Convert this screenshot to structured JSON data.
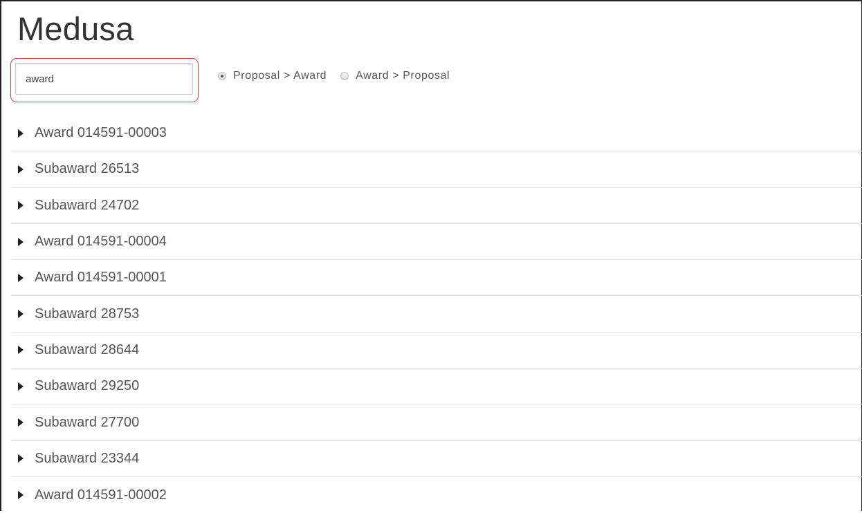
{
  "page": {
    "title": "Medusa"
  },
  "search": {
    "value": "award"
  },
  "direction": {
    "options": [
      {
        "label": "Proposal > Award",
        "checked": true
      },
      {
        "label": "Award > Proposal",
        "checked": false
      }
    ]
  },
  "colors": {
    "highlight": "#e0393e",
    "text": "#555555",
    "divider": "#e1e1e1"
  },
  "results": {
    "items": [
      {
        "label": "Award 014591-00003",
        "icon": "caret-right-icon"
      },
      {
        "label": "Subaward 26513",
        "icon": "caret-right-icon"
      },
      {
        "label": "Subaward 24702",
        "icon": "caret-right-icon"
      },
      {
        "label": "Award 014591-00004",
        "icon": "caret-right-icon"
      },
      {
        "label": "Award 014591-00001",
        "icon": "caret-right-icon"
      },
      {
        "label": "Subaward 28753",
        "icon": "caret-right-icon"
      },
      {
        "label": "Subaward 28644",
        "icon": "caret-right-icon"
      },
      {
        "label": "Subaward 29250",
        "icon": "caret-right-icon"
      },
      {
        "label": "Subaward 27700",
        "icon": "caret-right-icon"
      },
      {
        "label": "Subaward 23344",
        "icon": "caret-right-icon"
      },
      {
        "label": "Award 014591-00002",
        "icon": "caret-right-icon"
      }
    ]
  }
}
